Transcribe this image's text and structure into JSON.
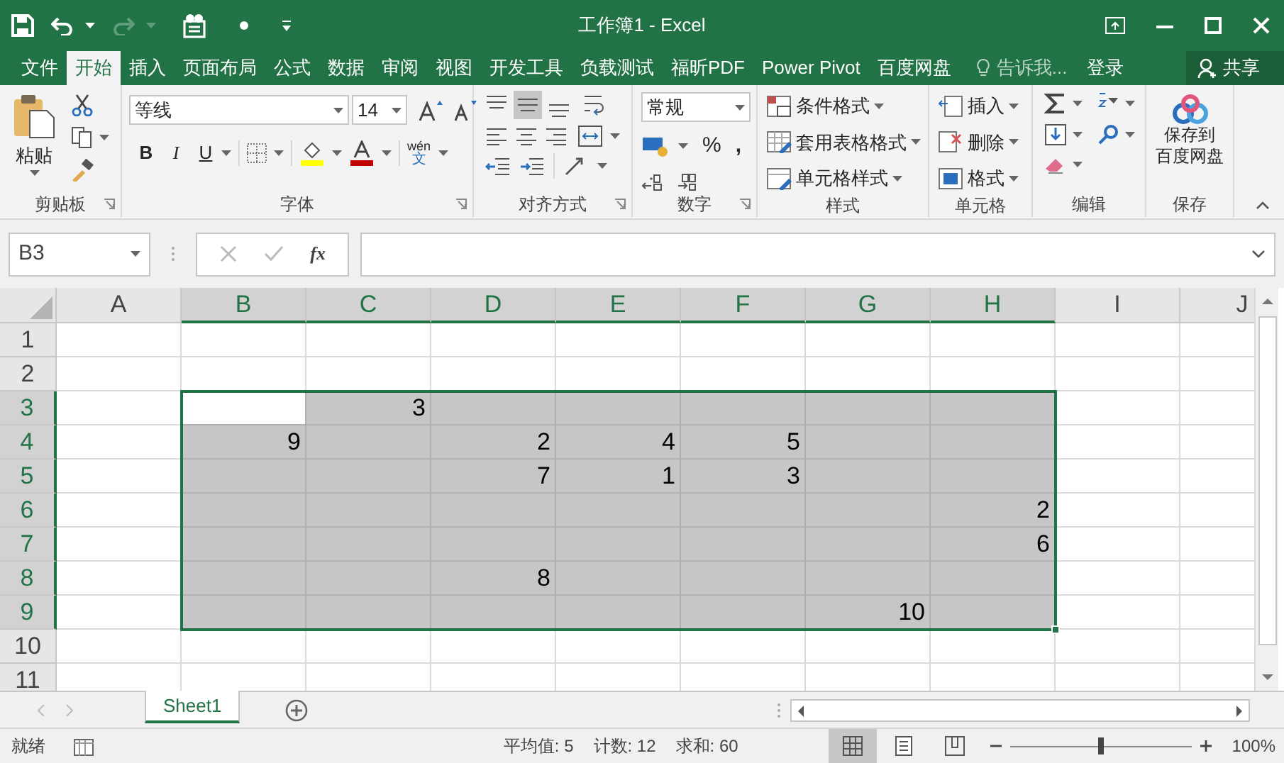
{
  "window": {
    "title": "工作簿1 - Excel"
  },
  "tabs": [
    {
      "label": "文件",
      "selected": false
    },
    {
      "label": "开始",
      "selected": true
    },
    {
      "label": "插入",
      "selected": false
    },
    {
      "label": "页面布局",
      "selected": false
    },
    {
      "label": "公式",
      "selected": false
    },
    {
      "label": "数据",
      "selected": false
    },
    {
      "label": "审阅",
      "selected": false
    },
    {
      "label": "视图",
      "selected": false
    },
    {
      "label": "开发工具",
      "selected": false
    },
    {
      "label": "负载测试",
      "selected": false
    },
    {
      "label": "福昕PDF",
      "selected": false
    },
    {
      "label": "Power Pivot",
      "selected": false
    },
    {
      "label": "百度网盘",
      "selected": false
    }
  ],
  "tell_me": {
    "placeholder": "告诉我..."
  },
  "sign_in": "登录",
  "share": "共享",
  "ribbon": {
    "clipboard": {
      "label": "剪贴板",
      "paste": "粘贴"
    },
    "font": {
      "label": "字体",
      "name": "等线",
      "size": "14",
      "bold": "B",
      "italic": "I",
      "underline": "U",
      "phonetic": "wén",
      "phonetic_char": "文"
    },
    "alignment": {
      "label": "对齐方式",
      "vertical": [
        {
          "selected": false
        },
        {
          "selected": true
        },
        {
          "selected": false
        }
      ]
    },
    "number": {
      "label": "数字",
      "format": "常规",
      "percent": "%",
      "comma": ","
    },
    "styles": {
      "label": "样式",
      "items": [
        "条件格式",
        "套用表格格式",
        "单元格样式"
      ]
    },
    "cells": {
      "label": "单元格",
      "items": [
        "插入",
        "删除",
        "格式"
      ]
    },
    "editing": {
      "label": "编辑"
    },
    "save": {
      "label": "保存",
      "button": [
        "保存到",
        "百度网盘"
      ]
    }
  },
  "formula_bar": {
    "name_box": "B3",
    "function_label": "fx"
  },
  "sheet": {
    "columns": [
      {
        "label": "A",
        "selected": false
      },
      {
        "label": "B",
        "selected": true
      },
      {
        "label": "C",
        "selected": true
      },
      {
        "label": "D",
        "selected": true
      },
      {
        "label": "E",
        "selected": true
      },
      {
        "label": "F",
        "selected": true
      },
      {
        "label": "G",
        "selected": true
      },
      {
        "label": "H",
        "selected": true
      },
      {
        "label": "I",
        "selected": false
      },
      {
        "label": "J",
        "selected": false
      }
    ],
    "rows": [
      {
        "label": "1",
        "selected": false,
        "cells": [
          null,
          null,
          null,
          null,
          null,
          null,
          null,
          null,
          null,
          null
        ]
      },
      {
        "label": "2",
        "selected": false,
        "cells": [
          null,
          null,
          null,
          null,
          null,
          null,
          null,
          null,
          null,
          null
        ]
      },
      {
        "label": "3",
        "selected": true,
        "cells": [
          null,
          null,
          "3",
          null,
          null,
          null,
          null,
          null,
          null,
          null
        ]
      },
      {
        "label": "4",
        "selected": true,
        "cells": [
          null,
          "9",
          null,
          "2",
          "4",
          "5",
          null,
          null,
          null,
          null
        ]
      },
      {
        "label": "5",
        "selected": true,
        "cells": [
          null,
          null,
          null,
          "7",
          "1",
          "3",
          null,
          null,
          null,
          null
        ]
      },
      {
        "label": "6",
        "selected": true,
        "cells": [
          null,
          null,
          null,
          null,
          null,
          null,
          null,
          "2",
          null,
          null
        ]
      },
      {
        "label": "7",
        "selected": true,
        "cells": [
          null,
          null,
          null,
          null,
          null,
          null,
          null,
          "6",
          null,
          null
        ]
      },
      {
        "label": "8",
        "selected": true,
        "cells": [
          null,
          null,
          null,
          "8",
          null,
          null,
          null,
          null,
          null,
          null
        ]
      },
      {
        "label": "9",
        "selected": true,
        "cells": [
          null,
          null,
          null,
          null,
          null,
          null,
          "10",
          null,
          null,
          null
        ]
      },
      {
        "label": "10",
        "selected": false,
        "cells": [
          null,
          null,
          null,
          null,
          null,
          null,
          null,
          null,
          null,
          null
        ]
      },
      {
        "label": "11",
        "selected": false,
        "cells": [
          null,
          null,
          null,
          null,
          null,
          null,
          null,
          null,
          null,
          null
        ]
      }
    ]
  },
  "sheet_tabs": [
    {
      "label": "Sheet1",
      "selected": true
    }
  ],
  "status_bar": {
    "mode": "就绪",
    "average": "平均值: 5",
    "count": "计数: 12",
    "sum": "求和: 60",
    "views": [
      {
        "selected": true
      },
      {
        "selected": false
      },
      {
        "selected": false
      }
    ],
    "zoom": {
      "level": 0.5
    },
    "zoom_label": "100%"
  }
}
